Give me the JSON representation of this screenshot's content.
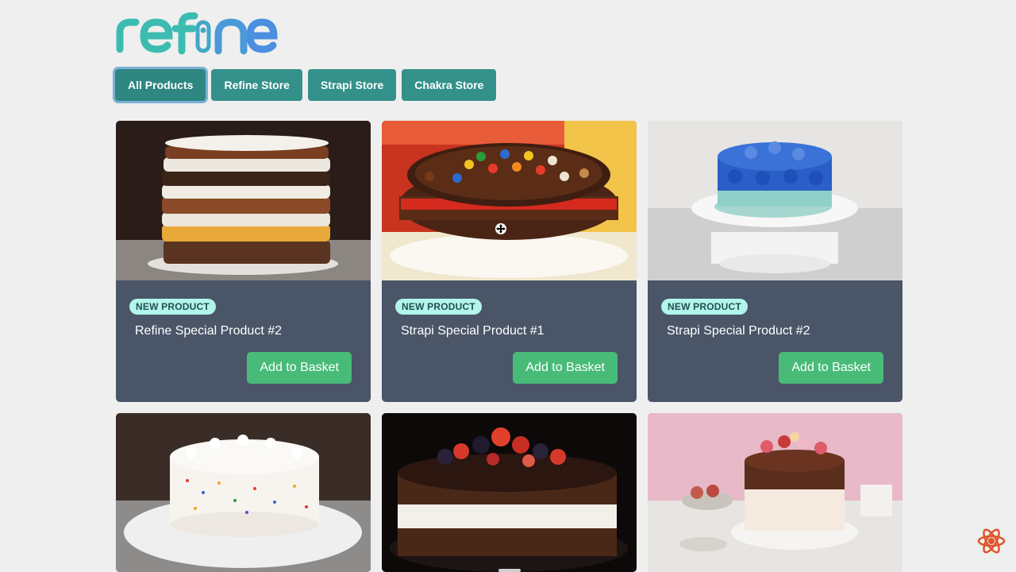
{
  "brand": {
    "logo_text": "refine",
    "colors": {
      "teal": "#3cbcb0",
      "blue": "#4a8fe0"
    }
  },
  "tabs": [
    {
      "label": "All Products",
      "active": true
    },
    {
      "label": "Refine Store",
      "active": false
    },
    {
      "label": "Strapi Store",
      "active": false
    },
    {
      "label": "Chakra Store",
      "active": false
    }
  ],
  "products": [
    {
      "badge": "NEW PRODUCT",
      "title": "Refine Special Product #2",
      "button": "Add to Basket",
      "image": "layered-naked-cake"
    },
    {
      "badge": "NEW PRODUCT",
      "title": "Strapi Special Product #1",
      "button": "Add to Basket",
      "image": "kitkat-candy-cake"
    },
    {
      "badge": "NEW PRODUCT",
      "title": "Strapi Special Product #2",
      "button": "Add to Basket",
      "image": "blue-rosette-cake"
    },
    {
      "image": "sprinkle-cake"
    },
    {
      "image": "berry-chocolate-drip-cake"
    },
    {
      "image": "pink-drip-macaron-cake"
    }
  ],
  "colors": {
    "tab_bg": "#34918a",
    "card_bg": "#4a5568",
    "button_bg": "#48bb78",
    "badge_bg": "#c6f6d5"
  }
}
